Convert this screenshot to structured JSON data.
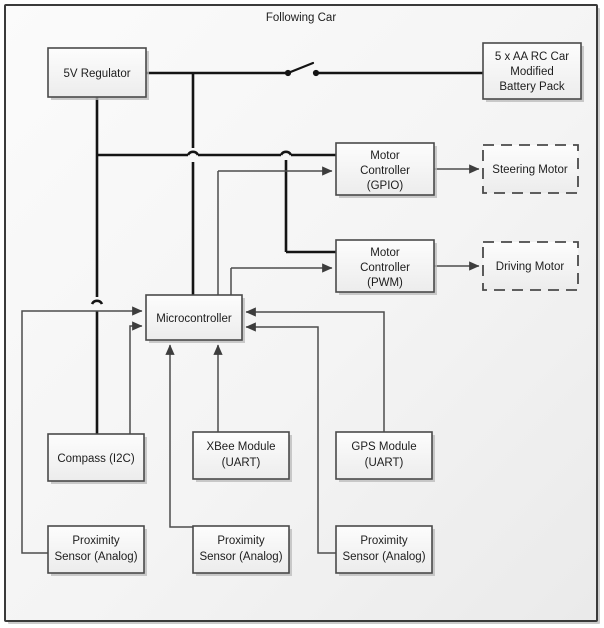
{
  "title": "Following Car",
  "colors": {
    "frame_border": "#3a3a3a",
    "frame_background": "#f2f2f2",
    "box_fill": "#f4f4f4",
    "box_border": "#4a4a4a",
    "power_wire": "#141414",
    "signal_wire": "#4d4d4d",
    "text": "#1d1d1d"
  },
  "nodes": {
    "regulator": {
      "label": "5V Regulator",
      "lines": [
        "5V Regulator"
      ]
    },
    "battery": {
      "label": "5 x AA RC Car Modified Battery Pack",
      "lines": [
        "5 x AA RC Car",
        "Modified",
        "Battery Pack"
      ]
    },
    "motor_controller_gpio": {
      "label": "Motor Controller (GPIO)",
      "lines": [
        "Motor",
        "Controller",
        "(GPIO)"
      ]
    },
    "motor_controller_pwm": {
      "label": "Motor Controller (PWM)",
      "lines": [
        "Motor",
        "Controller",
        "(PWM)"
      ]
    },
    "steering_motor": {
      "label": "Steering Motor",
      "lines": [
        "Steering Motor"
      ]
    },
    "driving_motor": {
      "label": "Driving Motor",
      "lines": [
        "Driving Motor"
      ]
    },
    "microcontroller": {
      "label": "Microcontroller",
      "lines": [
        "Microcontroller"
      ]
    },
    "compass": {
      "label": "Compass (I2C)",
      "lines": [
        "Compass (I2C)"
      ]
    },
    "xbee": {
      "label": "XBee Module (UART)",
      "lines": [
        "XBee Module",
        "(UART)"
      ]
    },
    "gps": {
      "label": "GPS Module (UART)",
      "lines": [
        "GPS Module",
        "(UART)"
      ]
    },
    "proximity_left": {
      "label": "Proximity Sensor (Analog)",
      "lines": [
        "Proximity",
        "Sensor (Analog)"
      ]
    },
    "proximity_center": {
      "label": "Proximity Sensor (Analog)",
      "lines": [
        "Proximity",
        "Sensor (Analog)"
      ]
    },
    "proximity_right": {
      "label": "Proximity Sensor (Analog)",
      "lines": [
        "Proximity",
        "Sensor (Analog)"
      ]
    }
  },
  "switch": {
    "name": "power-switch",
    "state": "open"
  }
}
